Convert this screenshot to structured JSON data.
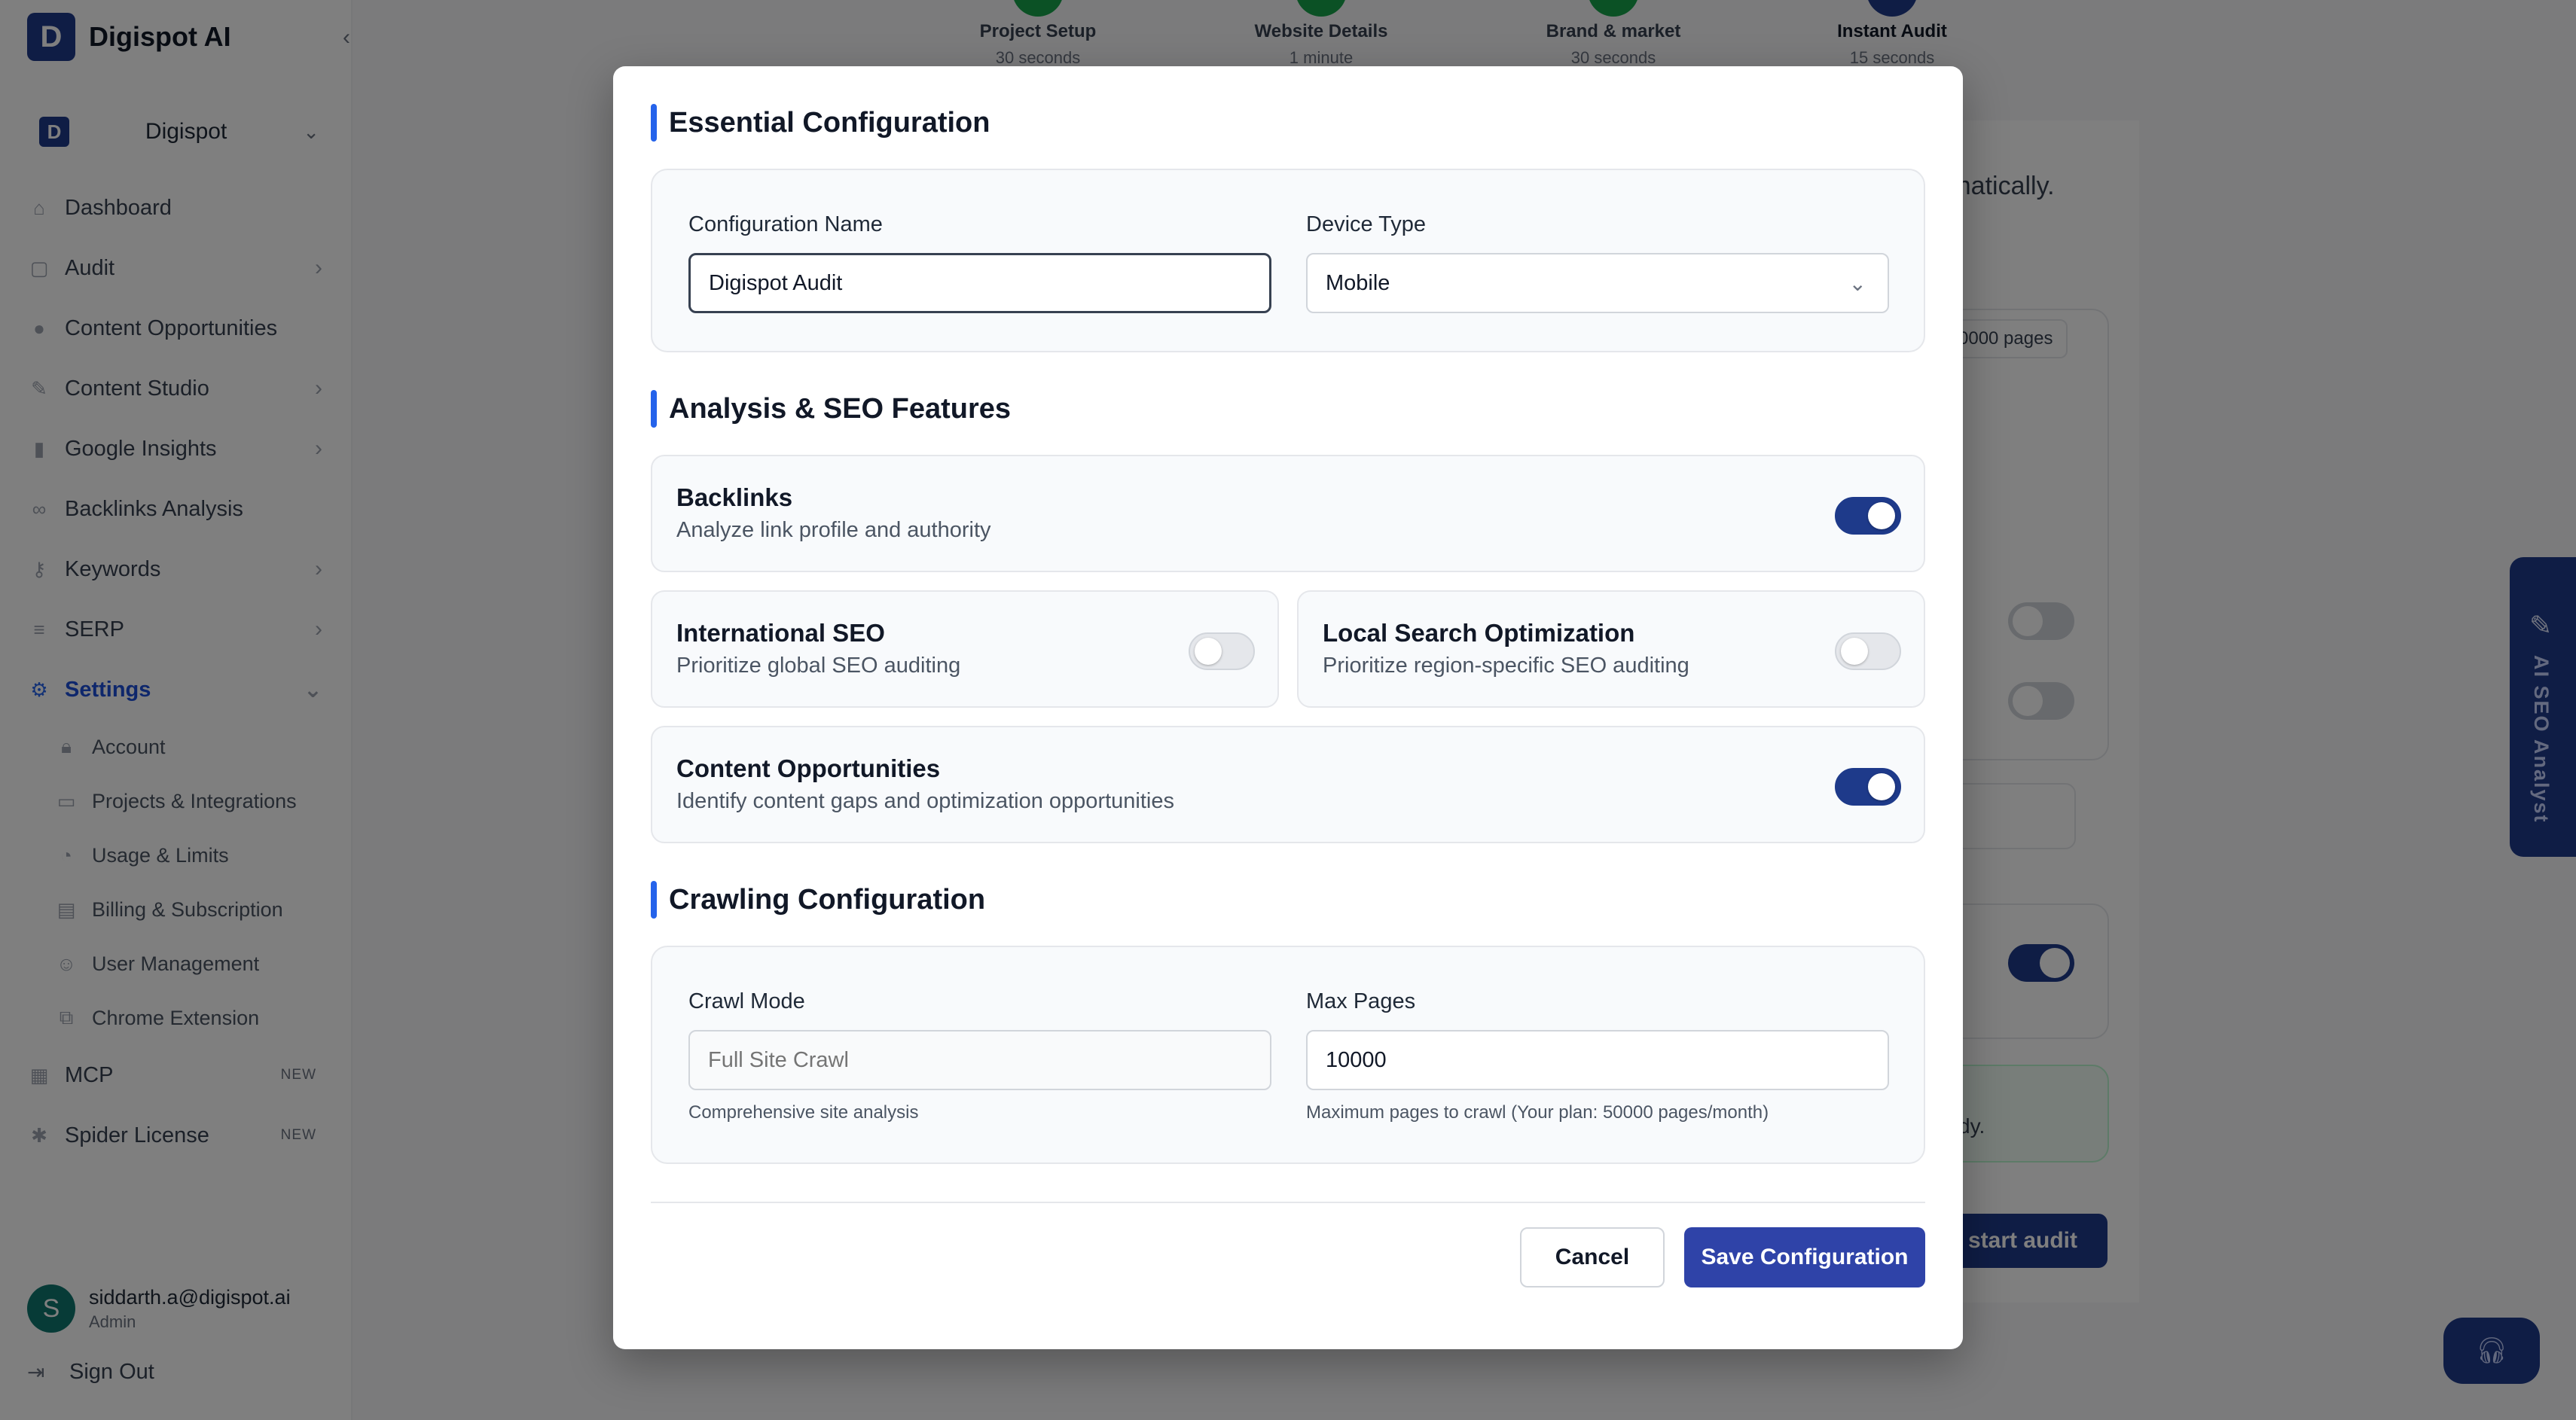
{
  "app": {
    "name": "Digispot AI",
    "logo_letter": "D"
  },
  "sidebar": {
    "project": "Digispot",
    "items": [
      {
        "label": "Dashboard",
        "icon": "home-icon"
      },
      {
        "label": "Audit",
        "icon": "clipboard-icon"
      },
      {
        "label": "Content Opportunities",
        "icon": "circle-icon"
      },
      {
        "label": "Content Studio",
        "icon": "wand-icon"
      },
      {
        "label": "Google Insights",
        "icon": "bar-chart-icon"
      },
      {
        "label": "Backlinks Analysis",
        "icon": "link-icon"
      },
      {
        "label": "Keywords",
        "icon": "key-icon"
      },
      {
        "label": "SERP",
        "icon": "list-icon"
      },
      {
        "label": "Settings",
        "icon": "gear-icon"
      }
    ],
    "settings_sub": [
      {
        "label": "Account"
      },
      {
        "label": "Projects & Integrations"
      },
      {
        "label": "Usage & Limits"
      },
      {
        "label": "Billing & Subscription"
      },
      {
        "label": "User Management"
      },
      {
        "label": "Chrome Extension"
      }
    ],
    "extra": [
      {
        "label": "MCP",
        "badge": "NEW"
      },
      {
        "label": "Spider License",
        "badge": "NEW"
      }
    ],
    "user": {
      "initial": "S",
      "email": "siddarth.a@digispot.ai",
      "role": "Admin"
    },
    "signout": "Sign Out"
  },
  "stepper": [
    {
      "title": "Project Setup",
      "sub": "30 seconds"
    },
    {
      "title": "Website Details",
      "sub": "1 minute"
    },
    {
      "title": "Brand & market",
      "sub": "30 seconds"
    },
    {
      "title": "Instant Audit",
      "sub": "15 seconds"
    }
  ],
  "background": {
    "partial_text": "tomatically.",
    "pages_chip": "0000 pages",
    "ready_text": "dy.",
    "start_button": "start audit",
    "ai_tab": "AI SEO Analyst"
  },
  "modal": {
    "essential": {
      "title": "Essential Configuration",
      "config_name_label": "Configuration Name",
      "config_name_value": "Digispot Audit",
      "device_label": "Device Type",
      "device_value": "Mobile"
    },
    "analysis": {
      "title": "Analysis & SEO Features",
      "features": [
        {
          "title": "Backlinks",
          "desc": "Analyze link profile and authority",
          "enabled": true
        },
        {
          "title": "International SEO",
          "desc": "Prioritize global SEO auditing",
          "enabled": false
        },
        {
          "title": "Local Search Optimization",
          "desc": "Prioritize region-specific SEO auditing",
          "enabled": false
        },
        {
          "title": "Content Opportunities",
          "desc": "Identify content gaps and optimization opportunities",
          "enabled": true
        }
      ]
    },
    "crawling": {
      "title": "Crawling Configuration",
      "mode_label": "Crawl Mode",
      "mode_placeholder": "Full Site Crawl",
      "mode_help": "Comprehensive site analysis",
      "max_label": "Max Pages",
      "max_value": "10000",
      "max_help": "Maximum pages to crawl (Your plan: 50000 pages/month)"
    },
    "buttons": {
      "cancel": "Cancel",
      "save": "Save Configuration"
    }
  }
}
